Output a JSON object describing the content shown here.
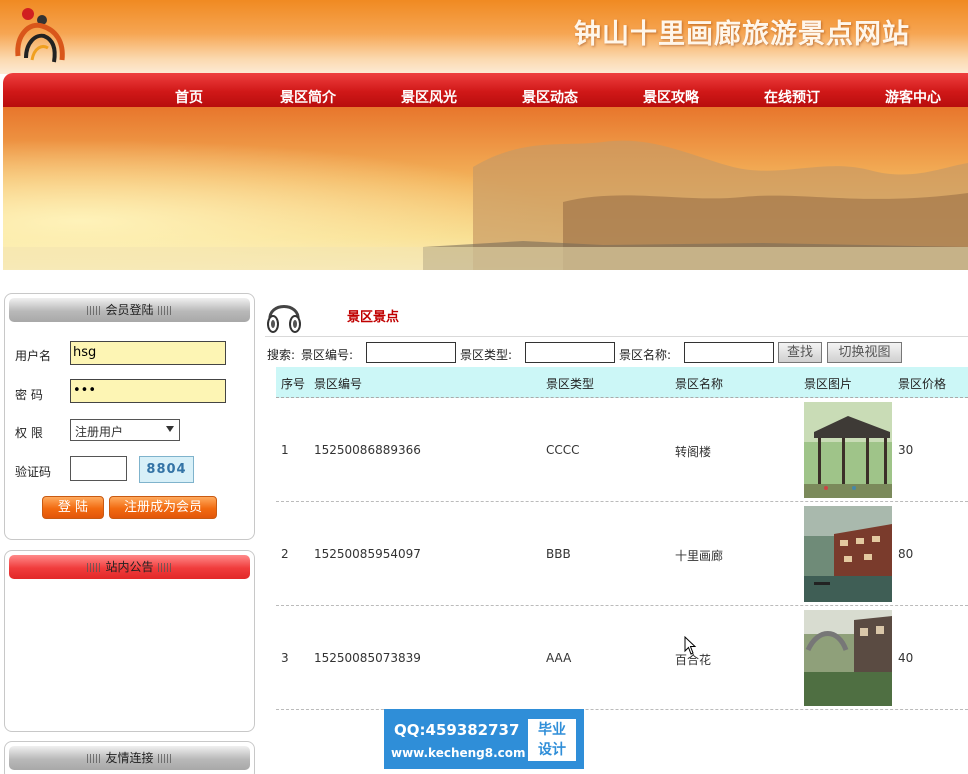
{
  "header": {
    "title": "钟山十里画廊旅游景点网站"
  },
  "nav": {
    "items": [
      "首页",
      "景区简介",
      "景区风光",
      "景区动态",
      "景区攻略",
      "在线预订",
      "游客中心"
    ]
  },
  "login_box": {
    "title": "会员登陆",
    "username_label": "用户名",
    "username_value": "hsg",
    "password_label": "密  码",
    "password_value": "•••",
    "role_label": "权  限",
    "role_value": "注册用户",
    "captcha_label": "验证码",
    "captcha_code": "8804",
    "login_button": "登 陆",
    "register_button": "注册成为会员"
  },
  "notice_box": {
    "title": "站内公告"
  },
  "links_box": {
    "title": "友情连接"
  },
  "main": {
    "section_title": "景区景点",
    "search": {
      "prefix": "搜索:",
      "id_label": "景区编号:",
      "type_label": "景区类型:",
      "name_label": "景区名称:",
      "find_button": "查找",
      "switch_button": "切换视图"
    },
    "table": {
      "columns": [
        "序号",
        "景区编号",
        "景区类型",
        "景区名称",
        "景区图片",
        "景区价格"
      ],
      "rows": [
        {
          "no": "1",
          "id": "15250086889366",
          "type": "CCCC",
          "name": "转阁楼",
          "price": "30"
        },
        {
          "no": "2",
          "id": "15250085954097",
          "type": "BBB",
          "name": "十里画廊",
          "price": "80"
        },
        {
          "no": "3",
          "id": "15250085073839",
          "type": "AAA",
          "name": "百合花",
          "price": "40"
        }
      ]
    }
  },
  "watermark": {
    "qq": "QQ:459382737",
    "url": "www.kecheng8.com",
    "badge_line1": "毕业",
    "badge_line2": "设计"
  },
  "colors": {
    "nav_red": "#d01818",
    "header_orange": "#f08a22",
    "title_red": "#c00000",
    "table_head": "#ccf7f7",
    "watermark_blue": "#2f8ed8"
  }
}
